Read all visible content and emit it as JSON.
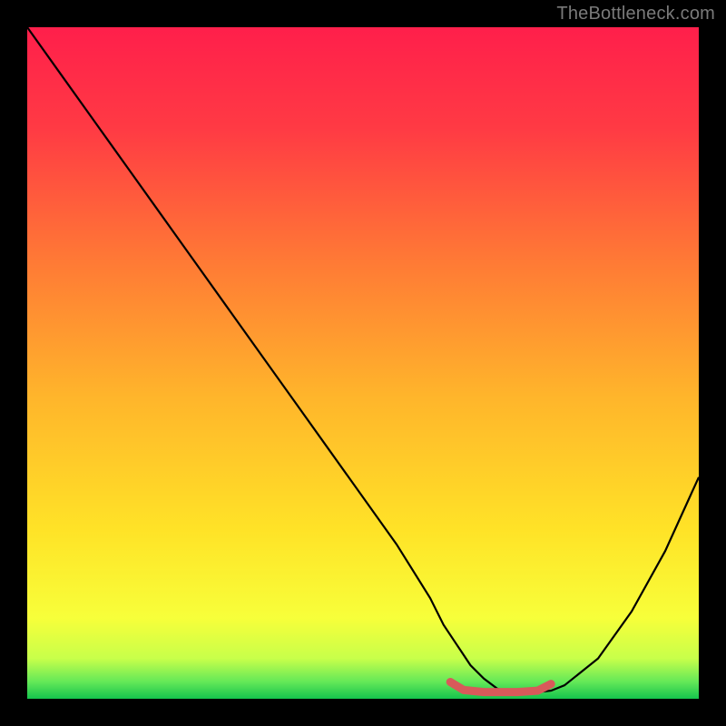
{
  "attribution": "TheBottleneck.com",
  "chart_data": {
    "type": "line",
    "title": "",
    "xlabel": "",
    "ylabel": "",
    "xlim": [
      0,
      100
    ],
    "ylim": [
      0,
      100
    ],
    "series": [
      {
        "name": "curve",
        "x": [
          0,
          5,
          10,
          15,
          20,
          25,
          30,
          35,
          40,
          45,
          50,
          55,
          60,
          62,
          64,
          66,
          68,
          70,
          72,
          74,
          76,
          78,
          80,
          85,
          90,
          95,
          100
        ],
        "y": [
          100,
          93,
          86,
          79,
          72,
          65,
          58,
          51,
          44,
          37,
          30,
          23,
          15,
          11,
          8,
          5,
          3,
          1.5,
          1,
          1,
          1,
          1.2,
          2,
          6,
          13,
          22,
          33
        ]
      },
      {
        "name": "highlight",
        "x": [
          63,
          78
        ],
        "y": [
          1,
          1
        ]
      }
    ],
    "gradient_stops": [
      {
        "offset": 0.0,
        "color": "#ff1f4b"
      },
      {
        "offset": 0.15,
        "color": "#ff3a44"
      },
      {
        "offset": 0.35,
        "color": "#ff7a35"
      },
      {
        "offset": 0.55,
        "color": "#ffb52b"
      },
      {
        "offset": 0.75,
        "color": "#ffe327"
      },
      {
        "offset": 0.88,
        "color": "#f7ff3a"
      },
      {
        "offset": 0.94,
        "color": "#c8ff4a"
      },
      {
        "offset": 0.975,
        "color": "#63e858"
      },
      {
        "offset": 1.0,
        "color": "#15c44d"
      }
    ]
  }
}
